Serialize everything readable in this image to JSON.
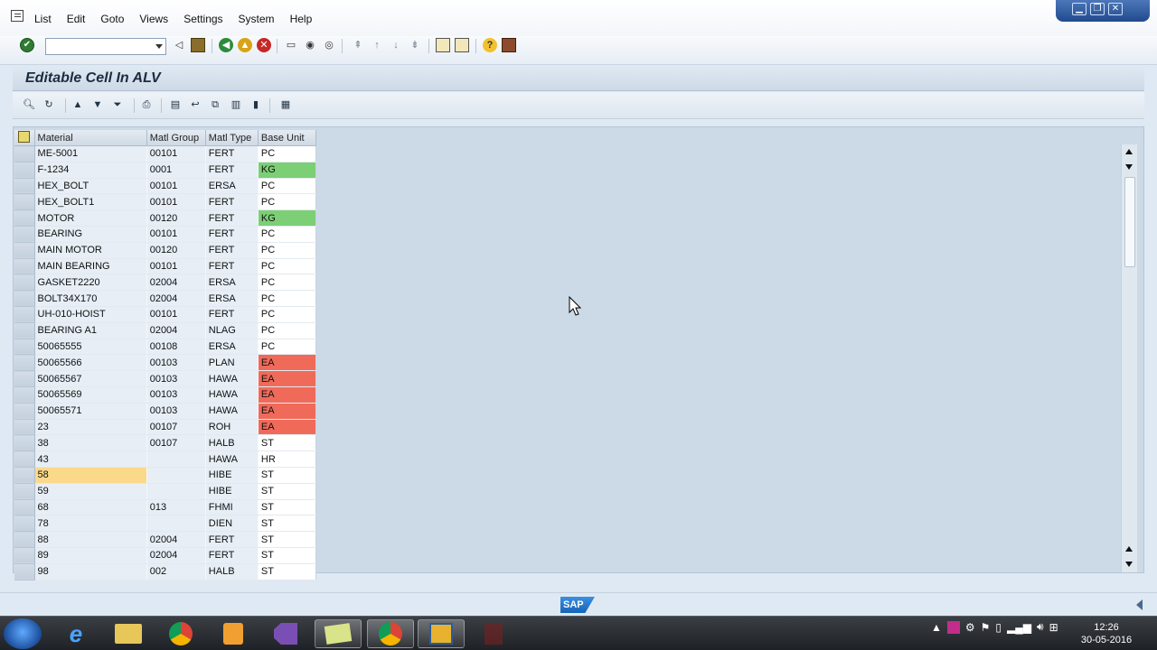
{
  "menu": {
    "items": [
      "List",
      "Edit",
      "Goto",
      "Views",
      "Settings",
      "System",
      "Help"
    ]
  },
  "window_controls": {
    "minimize": "▁",
    "restore": "❐",
    "close": "✕"
  },
  "command_field": {
    "value": ""
  },
  "title": "Editable Cell In ALV",
  "grid": {
    "columns": [
      "Material",
      "Matl Group",
      "Matl Type",
      "Base Unit"
    ],
    "rows": [
      {
        "material": "ME-5001",
        "group": "00101",
        "type": "FERT",
        "unit": "PC",
        "unit_color": ""
      },
      {
        "material": "F-1234",
        "group": "0001",
        "type": "FERT",
        "unit": "KG",
        "unit_color": "green"
      },
      {
        "material": "HEX_BOLT",
        "group": "00101",
        "type": "ERSA",
        "unit": "PC",
        "unit_color": ""
      },
      {
        "material": "HEX_BOLT1",
        "group": "00101",
        "type": "FERT",
        "unit": "PC",
        "unit_color": ""
      },
      {
        "material": "MOTOR",
        "group": "00120",
        "type": "FERT",
        "unit": "KG",
        "unit_color": "green"
      },
      {
        "material": "BEARING",
        "group": "00101",
        "type": "FERT",
        "unit": "PC",
        "unit_color": ""
      },
      {
        "material": "MAIN MOTOR",
        "group": "00120",
        "type": "FERT",
        "unit": "PC",
        "unit_color": ""
      },
      {
        "material": "MAIN BEARING",
        "group": "00101",
        "type": "FERT",
        "unit": "PC",
        "unit_color": ""
      },
      {
        "material": "GASKET2220",
        "group": "02004",
        "type": "ERSA",
        "unit": "PC",
        "unit_color": ""
      },
      {
        "material": "BOLT34X170",
        "group": "02004",
        "type": "ERSA",
        "unit": "PC",
        "unit_color": ""
      },
      {
        "material": "UH-010-HOIST",
        "group": "00101",
        "type": "FERT",
        "unit": "PC",
        "unit_color": ""
      },
      {
        "material": "BEARING A1",
        "group": "02004",
        "type": "NLAG",
        "unit": "PC",
        "unit_color": ""
      },
      {
        "material": "50065555",
        "group": "00108",
        "type": "ERSA",
        "unit": "PC",
        "unit_color": ""
      },
      {
        "material": "50065566",
        "group": "00103",
        "type": "PLAN",
        "unit": "EA",
        "unit_color": "red"
      },
      {
        "material": "50065567",
        "group": "00103",
        "type": "HAWA",
        "unit": "EA",
        "unit_color": "red"
      },
      {
        "material": "50065569",
        "group": "00103",
        "type": "HAWA",
        "unit": "EA",
        "unit_color": "red"
      },
      {
        "material": "50065571",
        "group": "00103",
        "type": "HAWA",
        "unit": "EA",
        "unit_color": "red"
      },
      {
        "material": "23",
        "group": "00107",
        "type": "ROH",
        "unit": "EA",
        "unit_color": "red"
      },
      {
        "material": "38",
        "group": "00107",
        "type": "HALB",
        "unit": "ST",
        "unit_color": ""
      },
      {
        "material": "43",
        "group": "",
        "type": "HAWA",
        "unit": "HR",
        "unit_color": ""
      },
      {
        "material": "58",
        "group": "",
        "type": "HIBE",
        "unit": "ST",
        "unit_color": "",
        "highlight": true
      },
      {
        "material": "59",
        "group": "",
        "type": "HIBE",
        "unit": "ST",
        "unit_color": ""
      },
      {
        "material": "68",
        "group": "013",
        "type": "FHMI",
        "unit": "ST",
        "unit_color": ""
      },
      {
        "material": "78",
        "group": "",
        "type": "DIEN",
        "unit": "ST",
        "unit_color": ""
      },
      {
        "material": "88",
        "group": "02004",
        "type": "FERT",
        "unit": "ST",
        "unit_color": ""
      },
      {
        "material": "89",
        "group": "02004",
        "type": "FERT",
        "unit": "ST",
        "unit_color": ""
      },
      {
        "material": "98",
        "group": "002",
        "type": "HALB",
        "unit": "ST",
        "unit_color": ""
      }
    ]
  },
  "status": {
    "logo_text": "SAP"
  },
  "taskbar": {
    "time": "12:26",
    "date": "30-05-2016"
  },
  "colors": {
    "unit_green": "#7ccf75",
    "unit_red": "#f06a5a",
    "highlight": "#fbd98a"
  }
}
